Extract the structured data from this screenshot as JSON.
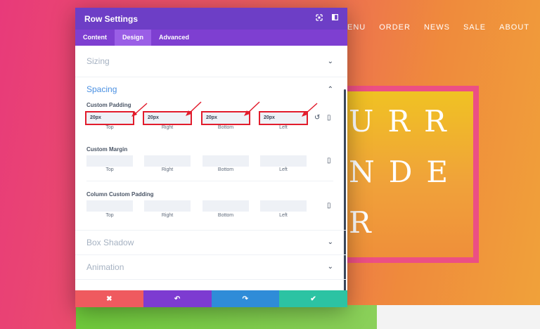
{
  "site": {
    "nav": [
      "ENU",
      "ORDER",
      "NEWS",
      "SALE",
      "ABOUT"
    ],
    "hero_lines": [
      "URR",
      "NDE",
      "R"
    ]
  },
  "modal": {
    "title": "Row Settings",
    "tabs": [
      "Content",
      "Design",
      "Advanced"
    ],
    "active_tab": "Design",
    "sections": {
      "sizing": "Sizing",
      "spacing": "Spacing",
      "box_shadow": "Box Shadow",
      "animation": "Animation"
    },
    "custom_padding": {
      "label": "Custom Padding",
      "values": [
        "20px",
        "20px",
        "20px",
        "20px"
      ],
      "captions": [
        "Top",
        "Right",
        "Bottom",
        "Left"
      ]
    },
    "custom_margin": {
      "label": "Custom Margin",
      "captions": [
        "Top",
        "Right",
        "Bottom",
        "Left"
      ]
    },
    "column_custom_padding": {
      "label": "Column Custom Padding",
      "captions": [
        "Top",
        "Right",
        "Bottom",
        "Left"
      ]
    },
    "footer": {
      "cancel": "✖",
      "undo": "↶",
      "redo": "↷",
      "save": "✔"
    }
  },
  "colors": {
    "header": "#6d3ec6",
    "tabs": "#7e3fd1",
    "highlight": "#e21c2c",
    "cancel": "#ef5a5f",
    "undo": "#7d3bd1",
    "redo": "#2f8cd8",
    "save": "#2cc3a3"
  },
  "icons": {
    "expand": "expand-icon",
    "sidebar": "sidebar-toggle-icon",
    "reset": "reset-icon",
    "responsive": "mobile-icon"
  }
}
